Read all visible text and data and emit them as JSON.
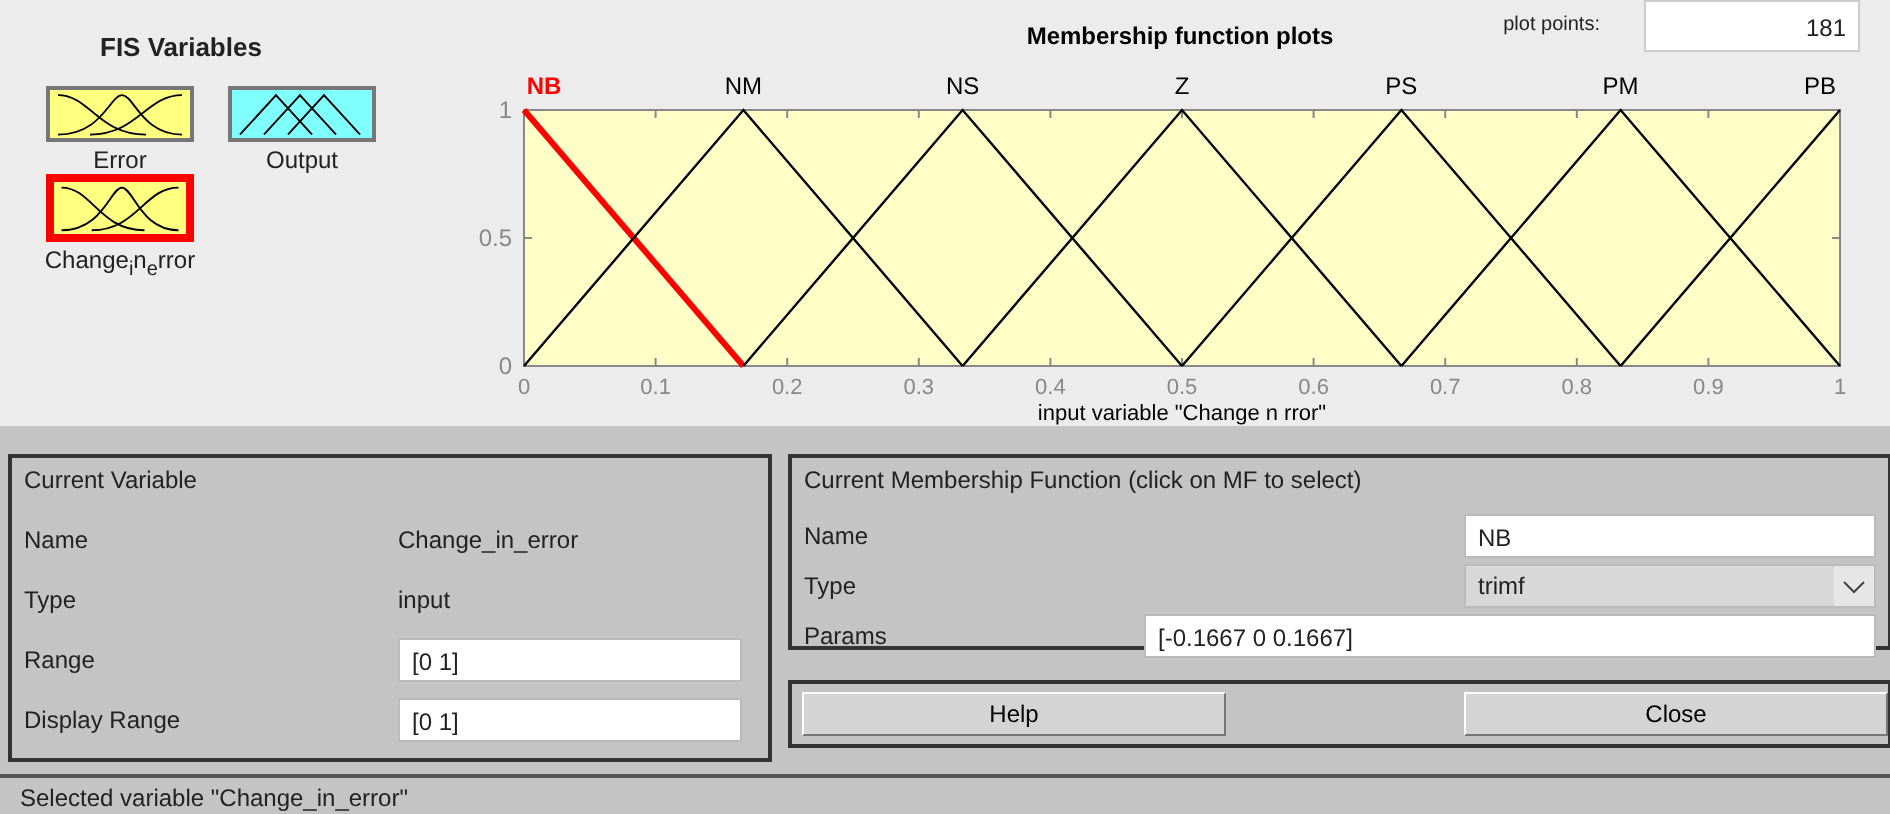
{
  "fis_variables": {
    "title": "FIS Variables",
    "items": [
      {
        "name": "Error",
        "kind": "input",
        "selected": false
      },
      {
        "name": "Output",
        "kind": "output",
        "selected": false
      },
      {
        "name": "Change$_{i}$n$_{e}$rror",
        "kind": "input",
        "selected": true
      }
    ]
  },
  "plot": {
    "plot_points_label": "plot points:",
    "plot_points": "181",
    "chart_data": {
      "type": "line",
      "title": "Membership function plots",
      "xlabel": "input variable \"Change n rror\"",
      "x": [
        0,
        0.1667,
        0.3333,
        0.5,
        0.6667,
        0.8333,
        1
      ],
      "series": [
        {
          "name": "NB",
          "color": "#ff0000",
          "values": [
            1,
            0,
            null,
            null,
            null,
            null,
            null
          ]
        },
        {
          "name": "NM",
          "color": "#000000",
          "values": [
            0,
            1,
            0,
            null,
            null,
            null,
            null
          ]
        },
        {
          "name": "NS",
          "color": "#000000",
          "values": [
            null,
            0,
            1,
            0,
            null,
            null,
            null
          ]
        },
        {
          "name": "Z",
          "color": "#000000",
          "values": [
            null,
            null,
            0,
            1,
            0,
            null,
            null
          ]
        },
        {
          "name": "PS",
          "color": "#000000",
          "values": [
            null,
            null,
            null,
            0,
            1,
            0,
            null
          ]
        },
        {
          "name": "PM",
          "color": "#000000",
          "values": [
            null,
            null,
            null,
            null,
            0,
            1,
            0
          ]
        },
        {
          "name": "PB",
          "color": "#000000",
          "values": [
            null,
            null,
            null,
            null,
            null,
            0,
            1
          ]
        }
      ],
      "xlim": [
        0,
        1
      ],
      "ylim": [
        0,
        1
      ],
      "xticks": [
        0,
        0.1,
        0.2,
        0.3,
        0.4,
        0.5,
        0.6,
        0.7,
        0.8,
        0.9,
        1
      ],
      "yticks": [
        0,
        0.5,
        1
      ]
    }
  },
  "current_variable": {
    "title": "Current Variable",
    "name_label": "Name",
    "name": "Change_in_error",
    "type_label": "Type",
    "type": "input",
    "range_label": "Range",
    "range": "[0 1]",
    "display_range_label": "Display Range",
    "display_range": "[0 1]"
  },
  "current_mf": {
    "title": "Current Membership Function (click on MF to select)",
    "name_label": "Name",
    "name": "NB",
    "type_label": "Type",
    "type": "trimf",
    "params_label": "Params",
    "params": "[-0.1667 0 0.1667]"
  },
  "buttons": [
    "Help",
    "Close"
  ],
  "status_bar": "Selected variable \"Change_in_error\""
}
